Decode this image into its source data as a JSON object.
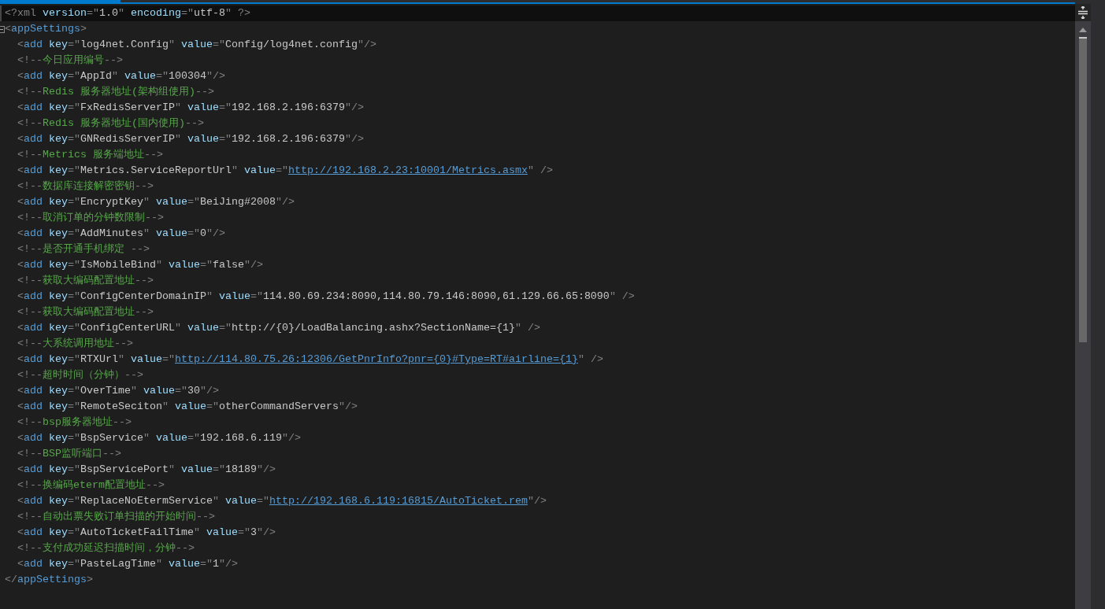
{
  "lines": [
    {
      "current": true,
      "tokens": [
        {
          "kind": "p",
          "text": "<?xml"
        },
        {
          "kind": "a",
          "text": " version"
        },
        {
          "kind": "p",
          "text": "=\""
        },
        {
          "kind": "s",
          "text": "1.0"
        },
        {
          "kind": "p",
          "text": "\""
        },
        {
          "kind": "a",
          "text": " encoding"
        },
        {
          "kind": "p",
          "text": "=\""
        },
        {
          "kind": "s",
          "text": "utf-8"
        },
        {
          "kind": "p",
          "text": "\" ?>"
        }
      ]
    },
    {
      "current": false,
      "expanded": true,
      "tokens": [
        {
          "kind": "p",
          "text": "<"
        },
        {
          "kind": "e",
          "text": "appSettings"
        },
        {
          "kind": "p",
          "text": ">"
        }
      ],
      "children": [
        {
          "tokens": [
            {
              "kind": "p",
              "text": "<"
            },
            {
              "kind": "e",
              "text": "add"
            },
            {
              "kind": "a",
              "text": " key"
            },
            {
              "kind": "p",
              "text": "=\""
            },
            {
              "kind": "s",
              "text": "log4net.Config"
            },
            {
              "kind": "p",
              "text": "\""
            },
            {
              "kind": "a",
              "text": " value"
            },
            {
              "kind": "p",
              "text": "=\""
            },
            {
              "kind": "s",
              "text": "Config/log4net.config"
            },
            {
              "kind": "p",
              "text": "\"/>"
            }
          ]
        },
        {
          "tokens": [
            {
              "kind": "p",
              "text": "<!--"
            },
            {
              "kind": "c",
              "text": "今日应用编号"
            },
            {
              "kind": "p",
              "text": "-->"
            }
          ]
        },
        {
          "tokens": [
            {
              "kind": "p",
              "text": "<"
            },
            {
              "kind": "e",
              "text": "add"
            },
            {
              "kind": "a",
              "text": " key"
            },
            {
              "kind": "p",
              "text": "=\""
            },
            {
              "kind": "s",
              "text": "AppId"
            },
            {
              "kind": "p",
              "text": "\""
            },
            {
              "kind": "a",
              "text": " value"
            },
            {
              "kind": "p",
              "text": "=\""
            },
            {
              "kind": "s",
              "text": "100304"
            },
            {
              "kind": "p",
              "text": "\"/>"
            }
          ]
        },
        {
          "tokens": [
            {
              "kind": "p",
              "text": "<!--"
            },
            {
              "kind": "c",
              "text": "Redis 服务器地址(架构组使用)"
            },
            {
              "kind": "p",
              "text": "-->"
            }
          ]
        },
        {
          "tokens": [
            {
              "kind": "p",
              "text": "<"
            },
            {
              "kind": "e",
              "text": "add"
            },
            {
              "kind": "a",
              "text": " key"
            },
            {
              "kind": "p",
              "text": "=\""
            },
            {
              "kind": "s",
              "text": "FxRedisServerIP"
            },
            {
              "kind": "p",
              "text": "\""
            },
            {
              "kind": "a",
              "text": " value"
            },
            {
              "kind": "p",
              "text": "=\""
            },
            {
              "kind": "s",
              "text": "192.168.2.196:6379"
            },
            {
              "kind": "p",
              "text": "\"/>"
            }
          ]
        },
        {
          "tokens": [
            {
              "kind": "p",
              "text": "<!--"
            },
            {
              "kind": "c",
              "text": "Redis 服务器地址(国内使用)"
            },
            {
              "kind": "p",
              "text": "-->"
            }
          ]
        },
        {
          "tokens": [
            {
              "kind": "p",
              "text": "<"
            },
            {
              "kind": "e",
              "text": "add"
            },
            {
              "kind": "a",
              "text": " key"
            },
            {
              "kind": "p",
              "text": "=\""
            },
            {
              "kind": "s",
              "text": "GNRedisServerIP"
            },
            {
              "kind": "p",
              "text": "\""
            },
            {
              "kind": "a",
              "text": " value"
            },
            {
              "kind": "p",
              "text": "=\""
            },
            {
              "kind": "s",
              "text": "192.168.2.196:6379"
            },
            {
              "kind": "p",
              "text": "\"/>"
            }
          ]
        },
        {
          "tokens": [
            {
              "kind": "p",
              "text": "<!--"
            },
            {
              "kind": "c",
              "text": "Metrics 服务端地址"
            },
            {
              "kind": "p",
              "text": "-->"
            }
          ]
        },
        {
          "tokens": [
            {
              "kind": "p",
              "text": "<"
            },
            {
              "kind": "e",
              "text": "add"
            },
            {
              "kind": "a",
              "text": " key"
            },
            {
              "kind": "p",
              "text": "=\""
            },
            {
              "kind": "s",
              "text": "Metrics.ServiceReportUrl"
            },
            {
              "kind": "p",
              "text": "\""
            },
            {
              "kind": "a",
              "text": " value"
            },
            {
              "kind": "p",
              "text": "=\""
            },
            {
              "kind": "l",
              "text": "http://192.168.2.23:10001/Metrics.asmx"
            },
            {
              "kind": "p",
              "text": "\" />"
            }
          ]
        },
        {
          "tokens": [
            {
              "kind": "p",
              "text": "<!--"
            },
            {
              "kind": "c",
              "text": "数据库连接解密密钥"
            },
            {
              "kind": "p",
              "text": "-->"
            }
          ]
        },
        {
          "tokens": [
            {
              "kind": "p",
              "text": "<"
            },
            {
              "kind": "e",
              "text": "add"
            },
            {
              "kind": "a",
              "text": " key"
            },
            {
              "kind": "p",
              "text": "=\""
            },
            {
              "kind": "s",
              "text": "EncryptKey"
            },
            {
              "kind": "p",
              "text": "\""
            },
            {
              "kind": "a",
              "text": " value"
            },
            {
              "kind": "p",
              "text": "=\""
            },
            {
              "kind": "s",
              "text": "BeiJing#2008"
            },
            {
              "kind": "p",
              "text": "\"/>"
            }
          ]
        },
        {
          "tokens": [
            {
              "kind": "p",
              "text": "<!--"
            },
            {
              "kind": "c",
              "text": "取消订单的分钟数限制"
            },
            {
              "kind": "p",
              "text": "-->"
            }
          ]
        },
        {
          "tokens": [
            {
              "kind": "p",
              "text": "<"
            },
            {
              "kind": "e",
              "text": "add"
            },
            {
              "kind": "a",
              "text": " key"
            },
            {
              "kind": "p",
              "text": "=\""
            },
            {
              "kind": "s",
              "text": "AddMinutes"
            },
            {
              "kind": "p",
              "text": "\""
            },
            {
              "kind": "a",
              "text": " value"
            },
            {
              "kind": "p",
              "text": "=\""
            },
            {
              "kind": "s",
              "text": "0"
            },
            {
              "kind": "p",
              "text": "\"/>"
            }
          ]
        },
        {
          "tokens": [
            {
              "kind": "p",
              "text": "<!--"
            },
            {
              "kind": "c",
              "text": "是否开通手机绑定 "
            },
            {
              "kind": "p",
              "text": "-->"
            }
          ]
        },
        {
          "tokens": [
            {
              "kind": "p",
              "text": "<"
            },
            {
              "kind": "e",
              "text": "add"
            },
            {
              "kind": "a",
              "text": " key"
            },
            {
              "kind": "p",
              "text": "=\""
            },
            {
              "kind": "s",
              "text": "IsMobileBind"
            },
            {
              "kind": "p",
              "text": "\""
            },
            {
              "kind": "a",
              "text": " value"
            },
            {
              "kind": "p",
              "text": "=\""
            },
            {
              "kind": "s",
              "text": "false"
            },
            {
              "kind": "p",
              "text": "\"/>"
            }
          ]
        },
        {
          "tokens": [
            {
              "kind": "p",
              "text": "<!--"
            },
            {
              "kind": "c",
              "text": "获取大编码配置地址"
            },
            {
              "kind": "p",
              "text": "-->"
            }
          ]
        },
        {
          "tokens": [
            {
              "kind": "p",
              "text": "<"
            },
            {
              "kind": "e",
              "text": "add"
            },
            {
              "kind": "a",
              "text": " key"
            },
            {
              "kind": "p",
              "text": "=\""
            },
            {
              "kind": "s",
              "text": "ConfigCenterDomainIP"
            },
            {
              "kind": "p",
              "text": "\""
            },
            {
              "kind": "a",
              "text": " value"
            },
            {
              "kind": "p",
              "text": "=\""
            },
            {
              "kind": "s",
              "text": "114.80.69.234:8090,114.80.79.146:8090,61.129.66.65:8090"
            },
            {
              "kind": "p",
              "text": "\" />"
            }
          ]
        },
        {
          "tokens": [
            {
              "kind": "p",
              "text": "<!--"
            },
            {
              "kind": "c",
              "text": "获取大编码配置地址"
            },
            {
              "kind": "p",
              "text": "-->"
            }
          ]
        },
        {
          "tokens": [
            {
              "kind": "p",
              "text": "<"
            },
            {
              "kind": "e",
              "text": "add"
            },
            {
              "kind": "a",
              "text": " key"
            },
            {
              "kind": "p",
              "text": "=\""
            },
            {
              "kind": "s",
              "text": "ConfigCenterURL"
            },
            {
              "kind": "p",
              "text": "\""
            },
            {
              "kind": "a",
              "text": " value"
            },
            {
              "kind": "p",
              "text": "=\""
            },
            {
              "kind": "s",
              "text": "http://{0}/LoadBalancing.ashx?SectionName={1}"
            },
            {
              "kind": "p",
              "text": "\" />"
            }
          ]
        },
        {
          "tokens": [
            {
              "kind": "p",
              "text": "<!--"
            },
            {
              "kind": "c",
              "text": "大系统调用地址"
            },
            {
              "kind": "p",
              "text": "-->"
            }
          ]
        },
        {
          "tokens": [
            {
              "kind": "p",
              "text": "<"
            },
            {
              "kind": "e",
              "text": "add"
            },
            {
              "kind": "a",
              "text": " key"
            },
            {
              "kind": "p",
              "text": "=\""
            },
            {
              "kind": "s",
              "text": "RTXUrl"
            },
            {
              "kind": "p",
              "text": "\""
            },
            {
              "kind": "a",
              "text": " value"
            },
            {
              "kind": "p",
              "text": "=\""
            },
            {
              "kind": "l",
              "text": "http://114.80.75.26:12306/GetPnrInfo?pnr={0}#Type=RT#airline={1}"
            },
            {
              "kind": "p",
              "text": "\" />"
            }
          ]
        },
        {
          "tokens": [
            {
              "kind": "p",
              "text": "<!--"
            },
            {
              "kind": "c",
              "text": "超时时间（分钟）"
            },
            {
              "kind": "p",
              "text": "-->"
            }
          ]
        },
        {
          "tokens": [
            {
              "kind": "p",
              "text": "<"
            },
            {
              "kind": "e",
              "text": "add"
            },
            {
              "kind": "a",
              "text": " key"
            },
            {
              "kind": "p",
              "text": "=\""
            },
            {
              "kind": "s",
              "text": "OverTime"
            },
            {
              "kind": "p",
              "text": "\""
            },
            {
              "kind": "a",
              "text": " value"
            },
            {
              "kind": "p",
              "text": "=\""
            },
            {
              "kind": "s",
              "text": "30"
            },
            {
              "kind": "p",
              "text": "\"/>"
            }
          ]
        },
        {
          "tokens": [
            {
              "kind": "p",
              "text": "<"
            },
            {
              "kind": "e",
              "text": "add"
            },
            {
              "kind": "a",
              "text": " key"
            },
            {
              "kind": "p",
              "text": "=\""
            },
            {
              "kind": "s",
              "text": "RemoteSeciton"
            },
            {
              "kind": "p",
              "text": "\""
            },
            {
              "kind": "a",
              "text": " value"
            },
            {
              "kind": "p",
              "text": "=\""
            },
            {
              "kind": "s",
              "text": "otherCommandServers"
            },
            {
              "kind": "p",
              "text": "\"/>"
            }
          ]
        },
        {
          "tokens": [
            {
              "kind": "p",
              "text": "<!--"
            },
            {
              "kind": "c",
              "text": "bsp服务器地址"
            },
            {
              "kind": "p",
              "text": "-->"
            }
          ]
        },
        {
          "tokens": [
            {
              "kind": "p",
              "text": "<"
            },
            {
              "kind": "e",
              "text": "add"
            },
            {
              "kind": "a",
              "text": " key"
            },
            {
              "kind": "p",
              "text": "=\""
            },
            {
              "kind": "s",
              "text": "BspService"
            },
            {
              "kind": "p",
              "text": "\""
            },
            {
              "kind": "a",
              "text": " value"
            },
            {
              "kind": "p",
              "text": "=\""
            },
            {
              "kind": "s",
              "text": "192.168.6.119"
            },
            {
              "kind": "p",
              "text": "\"/>"
            }
          ]
        },
        {
          "tokens": [
            {
              "kind": "p",
              "text": "<!--"
            },
            {
              "kind": "c",
              "text": "BSP监听端口"
            },
            {
              "kind": "p",
              "text": "-->"
            }
          ]
        },
        {
          "tokens": [
            {
              "kind": "p",
              "text": "<"
            },
            {
              "kind": "e",
              "text": "add"
            },
            {
              "kind": "a",
              "text": " key"
            },
            {
              "kind": "p",
              "text": "=\""
            },
            {
              "kind": "s",
              "text": "BspServicePort"
            },
            {
              "kind": "p",
              "text": "\""
            },
            {
              "kind": "a",
              "text": " value"
            },
            {
              "kind": "p",
              "text": "=\""
            },
            {
              "kind": "s",
              "text": "18189"
            },
            {
              "kind": "p",
              "text": "\"/>"
            }
          ]
        },
        {
          "tokens": [
            {
              "kind": "p",
              "text": "<!--"
            },
            {
              "kind": "c",
              "text": "换编码eterm配置地址"
            },
            {
              "kind": "p",
              "text": "-->"
            }
          ]
        },
        {
          "tokens": [
            {
              "kind": "p",
              "text": "<"
            },
            {
              "kind": "e",
              "text": "add"
            },
            {
              "kind": "a",
              "text": " key"
            },
            {
              "kind": "p",
              "text": "=\""
            },
            {
              "kind": "s",
              "text": "ReplaceNoEtermService"
            },
            {
              "kind": "p",
              "text": "\""
            },
            {
              "kind": "a",
              "text": " value"
            },
            {
              "kind": "p",
              "text": "=\""
            },
            {
              "kind": "l",
              "text": "http://192.168.6.119:16815/AutoTicket.rem"
            },
            {
              "kind": "p",
              "text": "\"/>"
            }
          ]
        },
        {
          "tokens": [
            {
              "kind": "p",
              "text": "<!--"
            },
            {
              "kind": "c",
              "text": "自动出票失败订单扫描的开始时间"
            },
            {
              "kind": "p",
              "text": "-->"
            }
          ]
        },
        {
          "tokens": [
            {
              "kind": "p",
              "text": "<"
            },
            {
              "kind": "e",
              "text": "add"
            },
            {
              "kind": "a",
              "text": " key"
            },
            {
              "kind": "p",
              "text": "=\""
            },
            {
              "kind": "s",
              "text": "AutoTicketFailTime"
            },
            {
              "kind": "p",
              "text": "\""
            },
            {
              "kind": "a",
              "text": " value"
            },
            {
              "kind": "p",
              "text": "=\""
            },
            {
              "kind": "s",
              "text": "3"
            },
            {
              "kind": "p",
              "text": "\"/>"
            }
          ]
        },
        {
          "tokens": [
            {
              "kind": "p",
              "text": "<!--"
            },
            {
              "kind": "c",
              "text": "支付成功延迟扫描时间，分钟"
            },
            {
              "kind": "p",
              "text": "-->"
            }
          ]
        },
        {
          "tokens": [
            {
              "kind": "p",
              "text": "<"
            },
            {
              "kind": "e",
              "text": "add"
            },
            {
              "kind": "a",
              "text": " key"
            },
            {
              "kind": "p",
              "text": "=\""
            },
            {
              "kind": "s",
              "text": "PasteLagTime"
            },
            {
              "kind": "p",
              "text": "\""
            },
            {
              "kind": "a",
              "text": " value"
            },
            {
              "kind": "p",
              "text": "=\""
            },
            {
              "kind": "s",
              "text": "1"
            },
            {
              "kind": "p",
              "text": "\"/>"
            }
          ]
        }
      ]
    },
    {
      "current": false,
      "tokens": [
        {
          "kind": "p",
          "text": "</"
        },
        {
          "kind": "e",
          "text": "appSettings"
        },
        {
          "kind": "p",
          "text": ">"
        }
      ]
    }
  ]
}
